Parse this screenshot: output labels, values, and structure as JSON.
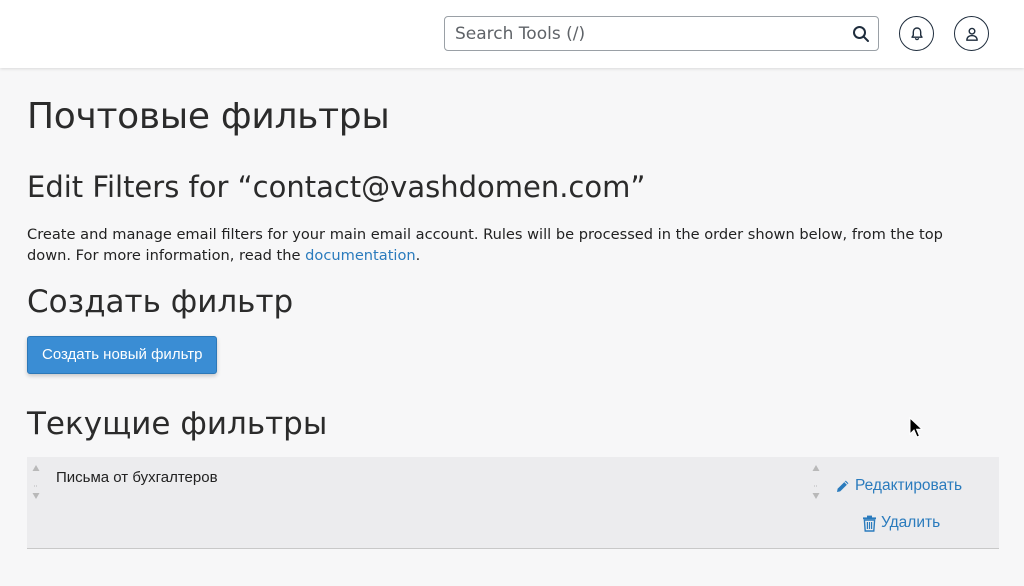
{
  "header": {
    "search": {
      "placeholder": "Search Tools (/)",
      "value": ""
    },
    "icons": {
      "search": "search-icon",
      "notifications": "bell-icon",
      "user": "user-icon"
    }
  },
  "main": {
    "page_title": "Почтовые фильтры",
    "edit_heading": "Edit Filters for “contact@vashdomen.com”",
    "description": {
      "text_before": "Create and manage email filters for your main email account. Rules will be processed in the order shown below, from the top down. For more information, read the ",
      "link": "documentation",
      "text_after": "."
    },
    "create_section": {
      "heading": "Создать фильтр",
      "button_label": "Создать новый фильтр"
    },
    "current_section": {
      "heading": "Текущие фильтры",
      "filters": [
        {
          "name": "Письма от бухгалтеров",
          "edit_label": "Редактировать",
          "delete_label": "Удалить"
        }
      ]
    }
  },
  "colors": {
    "accent": "#3a8dd4",
    "link": "#2a7bbd",
    "background": "#f7f7f8"
  }
}
